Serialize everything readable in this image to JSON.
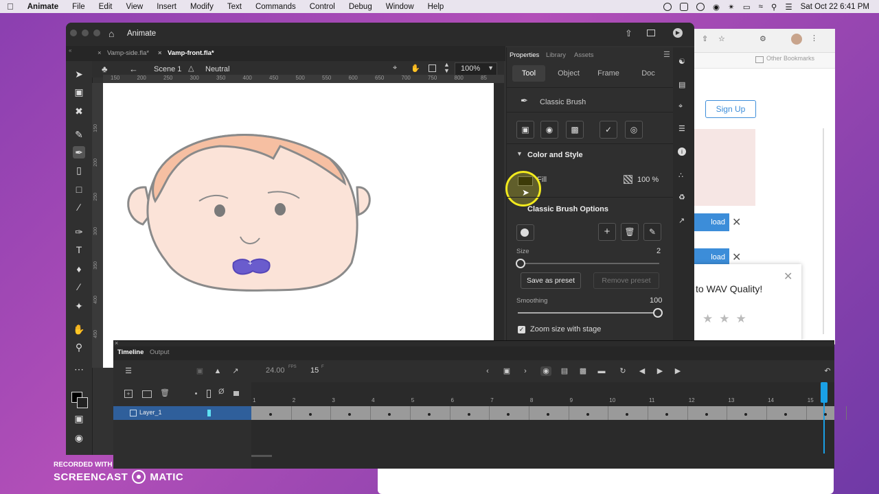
{
  "menubar": {
    "app": "Animate",
    "items": [
      "File",
      "Edit",
      "View",
      "Insert",
      "Modify",
      "Text",
      "Commands",
      "Control",
      "Debug",
      "Window",
      "Help"
    ],
    "datetime": "Sat Oct 22  6:41 PM"
  },
  "window": {
    "title": "Animate"
  },
  "doc_tabs": [
    {
      "label": "Vamp-side.fla*"
    },
    {
      "label": "Vamp-front.fla*"
    }
  ],
  "scene_bar": {
    "scene": "Scene 1",
    "symbol": "Neutral",
    "zoom": "100%"
  },
  "ruler_ticks": [
    "150",
    "200",
    "250",
    "300",
    "350",
    "400",
    "450",
    "500",
    "550",
    "600",
    "650",
    "700",
    "750",
    "800",
    "85"
  ],
  "vruler_ticks": [
    "150",
    "200",
    "250",
    "300",
    "350",
    "400",
    "450"
  ],
  "properties": {
    "tabs": [
      "Properties",
      "Library",
      "Assets"
    ],
    "segments": [
      "Tool",
      "Object",
      "Frame",
      "Doc"
    ],
    "active_segment": "Tool",
    "tool_name": "Classic Brush",
    "section_color": "Color and Style",
    "fill_label": "Fill",
    "fill_color": "#000000",
    "fill_alpha": "100 %",
    "section_brush": "Classic Brush Options",
    "size_label": "Size",
    "size_value": "2",
    "save_preset": "Save as preset",
    "remove_preset": "Remove preset",
    "smoothing_label": "Smoothing",
    "smoothing_value": "100",
    "zoom_label": "Zoom size with stage",
    "zoom_checked": true
  },
  "browser": {
    "bookmarks": "Other Bookmarks",
    "signup": "Sign Up",
    "load1": "load",
    "load2": "load",
    "popup_text": "to WAV Quality!"
  },
  "timeline": {
    "tabs": [
      "Timeline",
      "Output"
    ],
    "fps": "24.00",
    "fps_unit": "FPS",
    "frame": "15",
    "frame_unit": "F",
    "layer": "Layer_1",
    "frame_numbers": [
      "1",
      "2",
      "3",
      "4",
      "5",
      "6",
      "7",
      "8",
      "9",
      "10",
      "11",
      "12",
      "13",
      "14",
      "15"
    ]
  },
  "watermark": {
    "top": "RECORDED WITH",
    "left": "SCREENCAST",
    "right": "MATIC"
  },
  "colors": {
    "skin": "#fbe3d8",
    "hair": "#f6bfa2",
    "lips": "#6a5ccd",
    "outline": "#8a8a8a",
    "playhead": "#1aa0e6"
  }
}
